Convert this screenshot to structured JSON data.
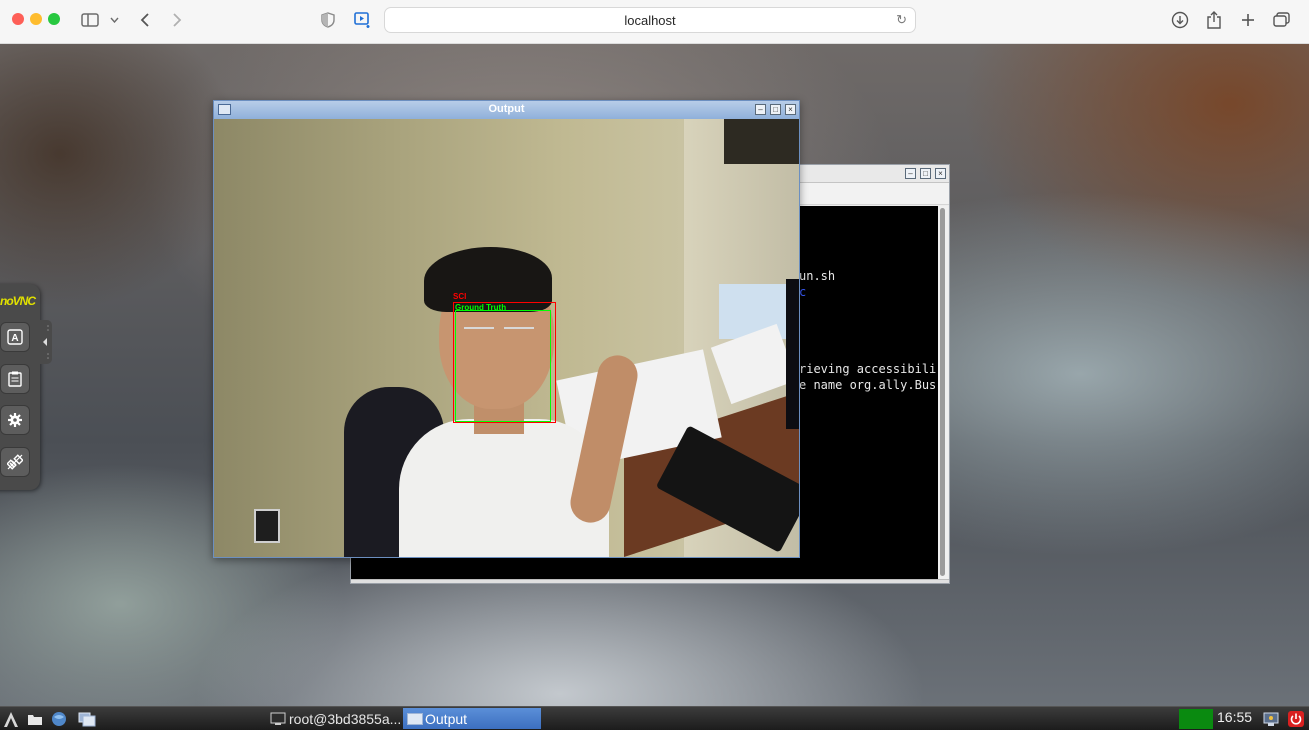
{
  "browser": {
    "url": "localhost",
    "icons": [
      "sidebar-icon",
      "chevron-down-icon",
      "back-icon",
      "forward-icon",
      "shield-icon",
      "media-icon",
      "reload-icon",
      "download-icon",
      "share-icon",
      "new-tab-icon",
      "tab-overview-icon"
    ]
  },
  "novnc": {
    "logo": "noVNC",
    "buttons": [
      "keyboard-icon",
      "clipboard-icon",
      "settings-icon",
      "disconnect-icon"
    ]
  },
  "terminal": {
    "lines": [
      "un.sh",
      "c",
      "rieving accessibili",
      "e name org.ally.Bus"
    ]
  },
  "output_window": {
    "title": "Output",
    "detections": [
      {
        "label": "SCI",
        "color": "#ff0000"
      },
      {
        "label": "Ground Truth",
        "color": "#00ff00"
      }
    ]
  },
  "taskbar": {
    "tasks": [
      {
        "label": "root@3bd3855a...",
        "active": false
      },
      {
        "label": "Output",
        "active": true
      }
    ],
    "clock": "16:55"
  }
}
